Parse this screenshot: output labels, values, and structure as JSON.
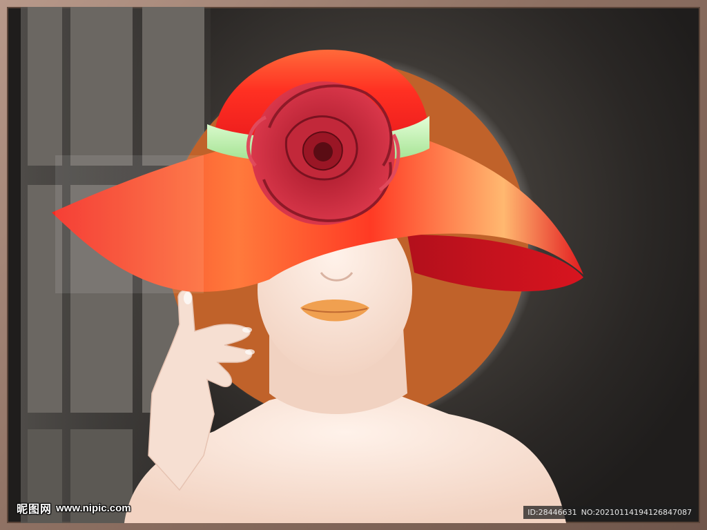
{
  "image": {
    "subject": "woman-in-red-hat-with-rose",
    "colors": {
      "frame": "#8d7062",
      "background": "#2a2725",
      "orange_disc": "#c0622a",
      "hat_red": "#f0221e",
      "hat_band": "#b9f0b0",
      "rose": "#c8283a",
      "skin": "#f5dccd",
      "lips": "#f0a050"
    }
  },
  "watermark": {
    "site_cn": "昵图网",
    "url": "www.nipic.com"
  },
  "id_strip": {
    "id_text": "ID:28446631",
    "no_text": "NO:20210114194126847087"
  }
}
